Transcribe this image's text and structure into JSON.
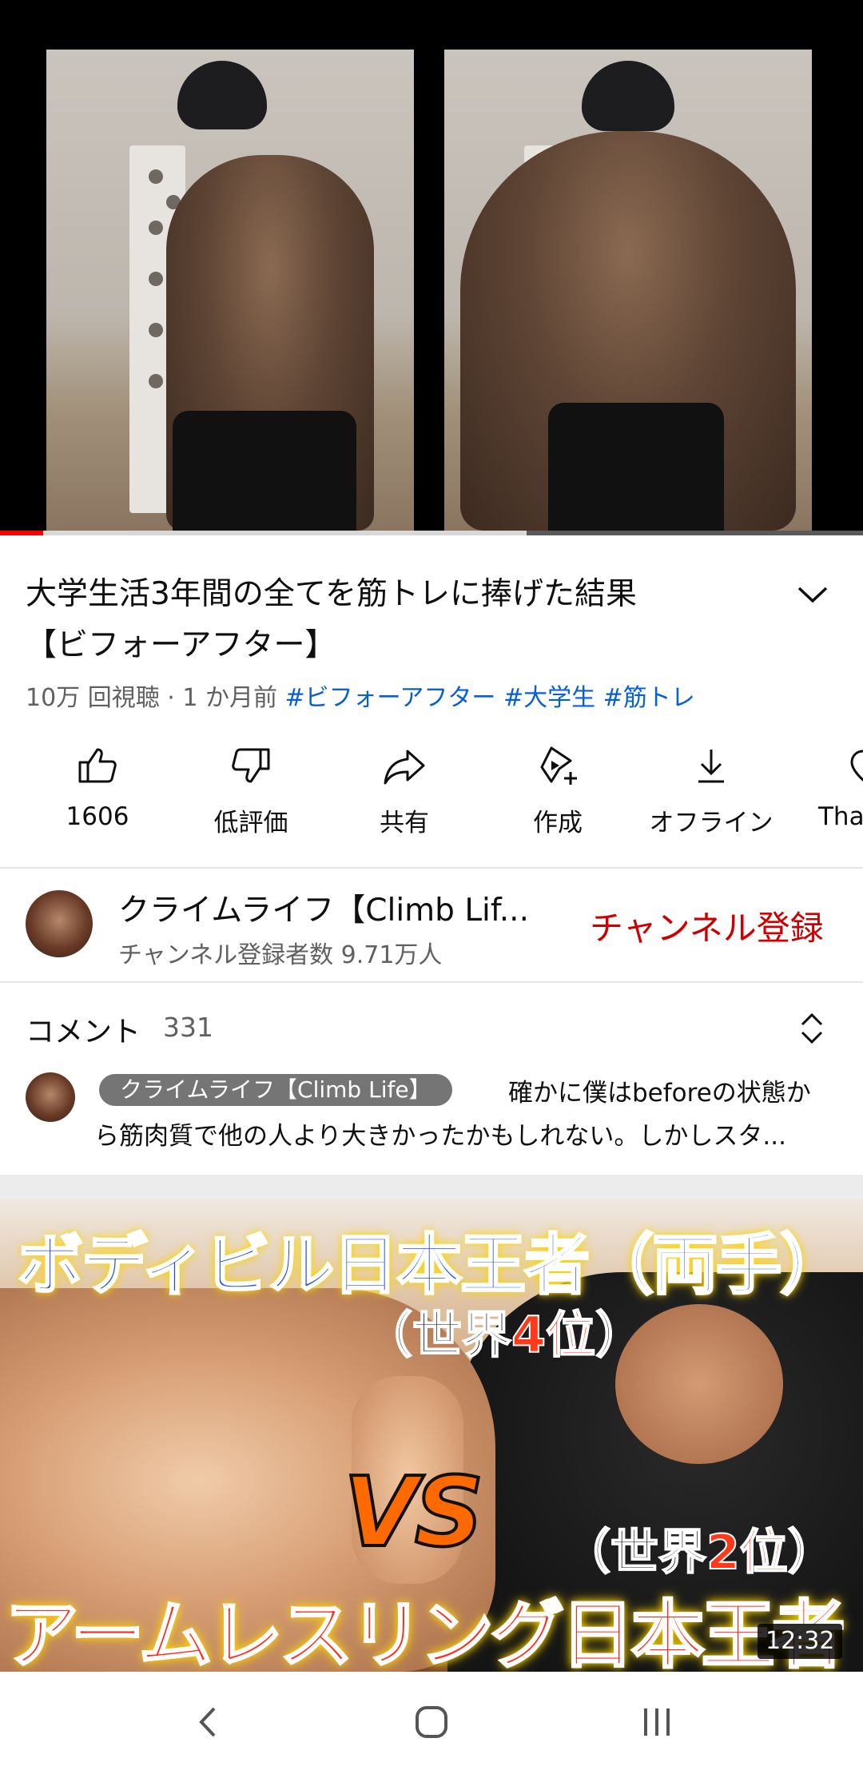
{
  "video": {
    "title": "大学生活3年間の全てを筋トレに捧げた結果【ビフォーアフター】",
    "title_line1": "大学生活3年間の全てを筋トレに捧げた結果",
    "title_line2": "【ビフォーアフター】",
    "views": "10万 回視聴",
    "sep": " · ",
    "age": "1 か月前",
    "hashtags": [
      "#ビフォーアフター",
      "#大学生",
      "#筋トレ"
    ],
    "progress_watched": 0.05,
    "progress_buffered": 0.61
  },
  "actions": [
    {
      "icon": "thumbs-up-icon",
      "label": "1606"
    },
    {
      "icon": "thumbs-down-icon",
      "label": "低評価"
    },
    {
      "icon": "share-icon",
      "label": "共有"
    },
    {
      "icon": "create-icon",
      "label": "作成"
    },
    {
      "icon": "download-icon",
      "label": "オフライン"
    },
    {
      "icon": "thanks-icon",
      "label": "Tha"
    }
  ],
  "channel": {
    "name": "クライムライフ【Climb Lif...",
    "subscribers": "チャンネル登録者数 9.71万人",
    "subscribe_label": "チャンネル登録"
  },
  "comments": {
    "label": "コメント",
    "count": "331",
    "top_comment": {
      "author": "クライムライフ【Climb Life】",
      "text_line1": "確かに僕はbeforeの状態か",
      "text_line2": "ら筋肉質で他の人より大きかったかもしれない。しかしスタ..."
    }
  },
  "next_video": {
    "thumb_line1": "ボディビル日本王者（両手）",
    "thumb_line2_a": "（世界",
    "thumb_line2_b": "4位",
    "thumb_line2_c": "）",
    "thumb_vs": "VS",
    "thumb_line3_a": "（世界",
    "thumb_line3_b": "2位",
    "thumb_line3_c": "）",
    "thumb_line4": "アームレスリング日本王者",
    "duration": "12:32"
  },
  "navbar": {
    "back": "back-icon",
    "home": "home-icon",
    "recents": "recents-icon"
  },
  "colors": {
    "subscribe": "#cc0000",
    "hashtag": "#065fd4",
    "progress": "#ff0000"
  }
}
